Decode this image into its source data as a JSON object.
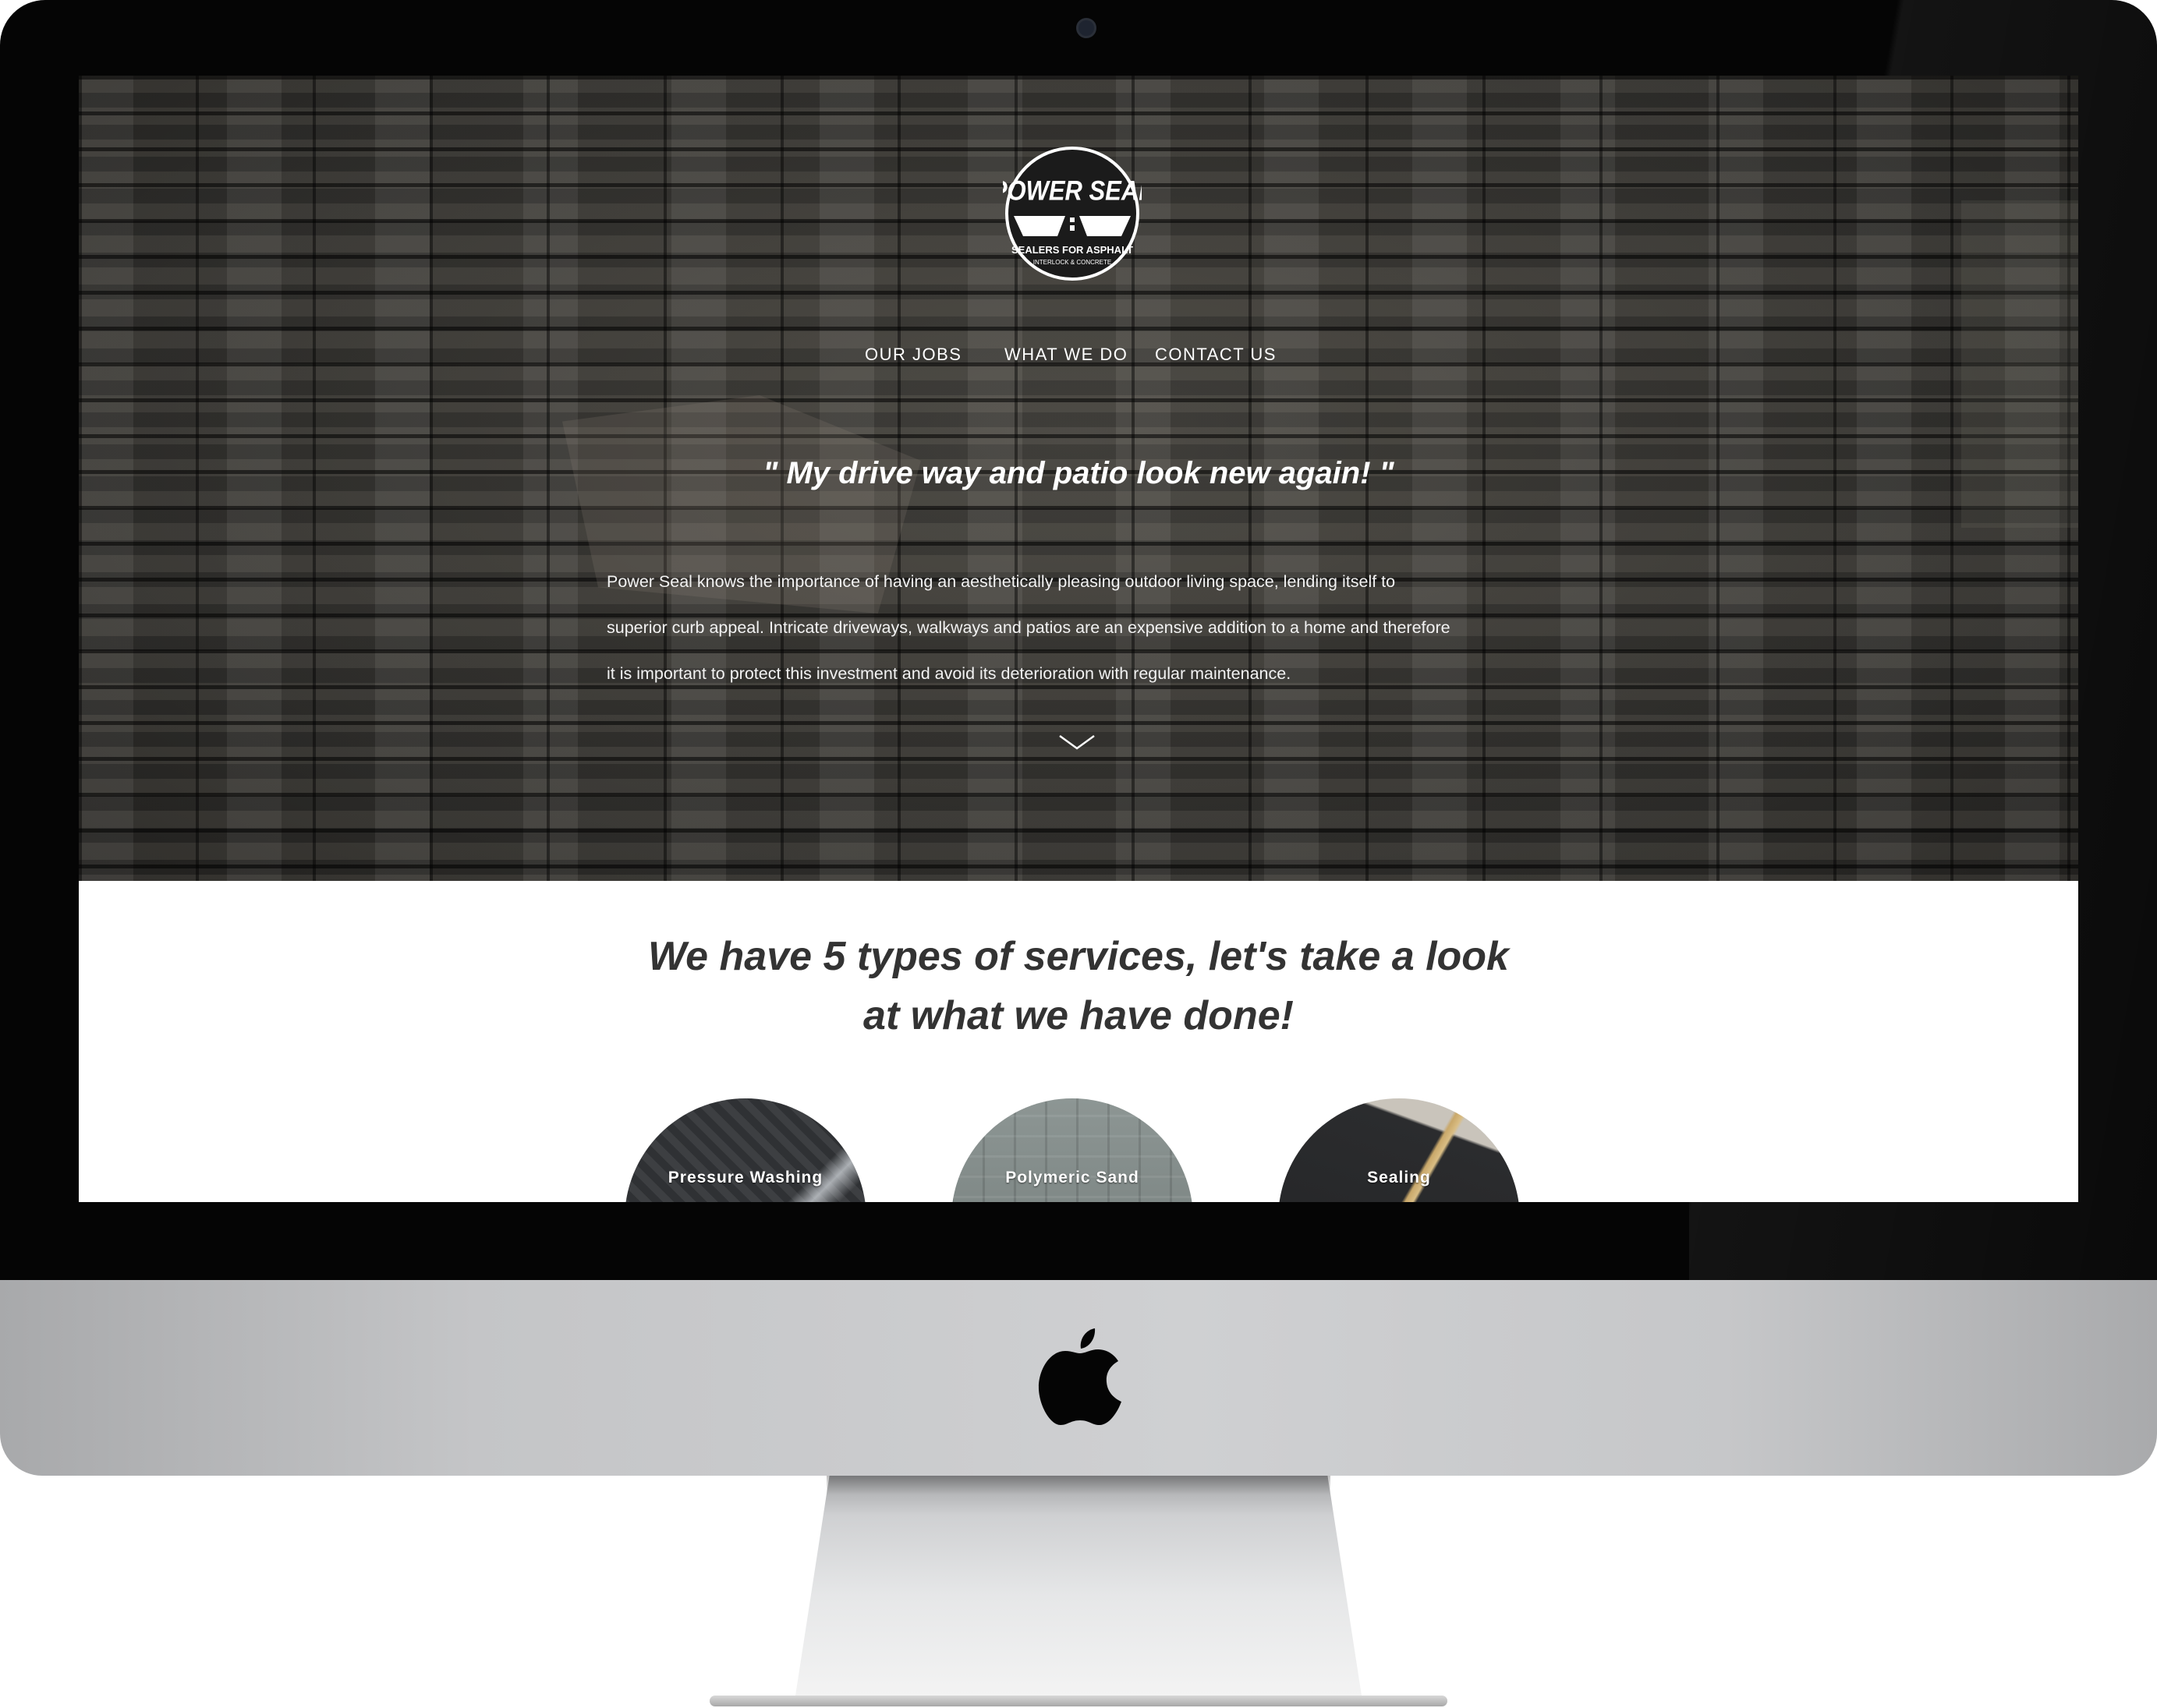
{
  "brand": {
    "logo_title": "POWER SEAL",
    "logo_tagline": "SEALERS FOR ASPHALT",
    "logo_subtagline": "INTERLOCK & CONCRETE"
  },
  "nav": {
    "items": [
      {
        "label": "OUR JOBS"
      },
      {
        "label": "WHAT WE DO"
      },
      {
        "label": "CONTACT US"
      }
    ]
  },
  "hero": {
    "quote": "\" My drive way and patio look new again! \"",
    "intro_lines": [
      "Power Seal knows the importance of having an aesthetically pleasing outdoor living space, lending itself to",
      "superior curb appeal. Intricate driveways, walkways and patios are an expensive addition to a home and therefore",
      "it is important to protect this investment and avoid its deterioration with regular maintenance."
    ],
    "scroll_icon": "chevron-down-icon"
  },
  "services": {
    "title_line1": "We have 5 types of services, let's take a look",
    "title_line2": "at what we have done!",
    "items": [
      {
        "label": "Pressure Washing"
      },
      {
        "label": "Polymeric Sand"
      },
      {
        "label": "Sealing"
      }
    ]
  },
  "device": {
    "logo_icon": "apple-logo-icon",
    "colors": {
      "bezel": "#050505",
      "chin": "#c9cacc",
      "hero_bg": "#3b3a37",
      "text_dark": "#333333"
    }
  }
}
